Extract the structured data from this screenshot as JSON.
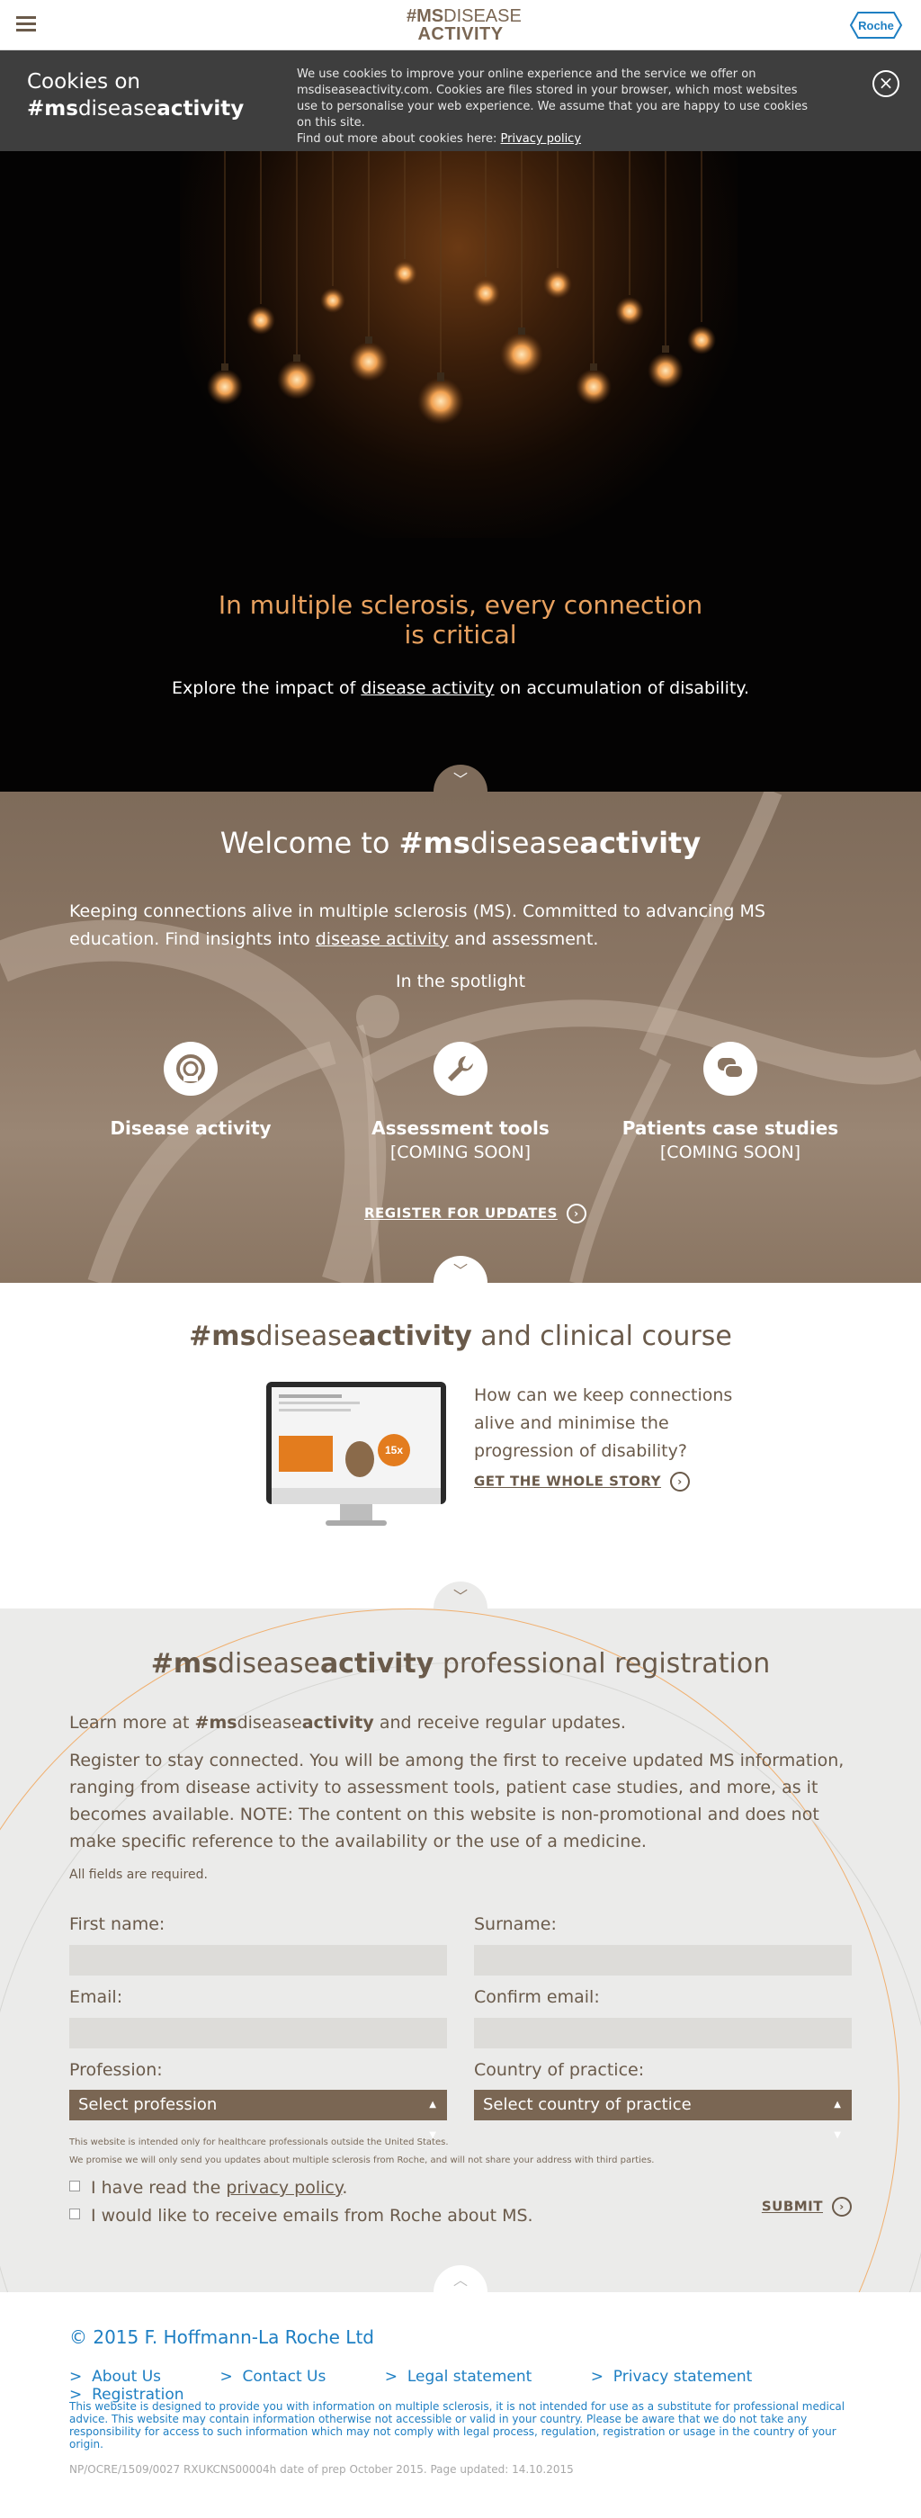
{
  "header": {
    "logo_line1_bold": "#MS",
    "logo_line1_rest": "DISEASE",
    "logo_line2": "ACTIVITY",
    "brand": "Roche",
    "colors": {
      "brand_brown": "#7a6653",
      "roche_blue": "#1e7fc3",
      "accent_orange": "#e8a15f"
    }
  },
  "cookie": {
    "title_line1": "Cookies on",
    "title_line2_pre": "#ms",
    "title_line2_mid": "disease",
    "title_line2_post": "activity",
    "text": "We use cookies to improve your online experience and the service we offer on msdiseaseactivity.com. Cookies are files stored in your browser, which most websites use to personalise your web experience. We assume that you are happy to use cookies on this site.",
    "find_out": "Find out more about cookies here: ",
    "privacy_link": "Privacy policy",
    "close_icon": "close-icon"
  },
  "hero": {
    "title_line1": "In multiple sclerosis, every connection",
    "title_line2": "is critical",
    "sub_pre": "Explore the impact of ",
    "sub_link": "disease activity",
    "sub_post": " on accumulation of disability."
  },
  "welcome": {
    "title_pre": "Welcome to ",
    "title_ms": "#ms",
    "title_disease": "disease",
    "title_activity": "activity",
    "intro_pre": "Keeping connections alive in multiple sclerosis (MS). Committed to advancing MS education. Find insights into ",
    "intro_link": "disease activity",
    "intro_post": " and assessment.",
    "spotlight": "In the spotlight",
    "features": [
      {
        "title": "Disease activity",
        "caption": "",
        "icon": "target-icon"
      },
      {
        "title": "Assessment tools",
        "caption": "[COMING SOON]",
        "icon": "wrench-icon"
      },
      {
        "title": "Patients case studies",
        "caption": "[COMING SOON]",
        "icon": "chat-bubbles-icon"
      }
    ],
    "register_link": "REGISTER FOR UPDATES"
  },
  "clinical": {
    "title_ms": "#ms",
    "title_disease": "disease",
    "title_activity": "activity",
    "title_post": " and clinical course",
    "question": "How can we keep connections alive and minimise the progression of disability?",
    "link": "GET THE WHOLE STORY",
    "monitor_badge": "15x"
  },
  "registration": {
    "title_ms": "#ms",
    "title_disease": "disease",
    "title_activity": "activity",
    "title_post": " professional registration",
    "learn_pre": "Learn more at ",
    "learn_ms": "#ms",
    "learn_disease": "disease",
    "learn_activity": "activity",
    "learn_post": " and receive regular updates.",
    "body": "Register to stay connected. You will be among the first to receive updated MS information, ranging from disease activity to assessment tools, patient case studies, and more, as it becomes available. NOTE: The content on this website is non-promotional and does not make specific reference to the availability or the use of a medicine.",
    "required": "All fields are required.",
    "first_name": "First name:",
    "surname": "Surname:",
    "email": "Email:",
    "confirm_email": "Confirm email:",
    "profession": "Profession:",
    "country": "Country of practice:",
    "profession_value": "Select profession",
    "country_value": "Select country of practice",
    "note1": "This website is intended only for healthcare professionals outside the United States.",
    "note2": "We promise we will only send you updates about multiple sclerosis from Roche, and will not share your address with third parties.",
    "check1_pre": "I have read the ",
    "check1_link": "privacy policy",
    "check1_post": ".",
    "check2": "I would like to receive emails from Roche about MS.",
    "submit": "SUBMIT"
  },
  "footer": {
    "copyright": "© 2015 F. Hoffmann-La Roche Ltd",
    "links": [
      "About Us",
      "Contact Us",
      "Legal statement",
      "Privacy statement",
      "Registration"
    ],
    "disclaimer": "This website is designed to provide you with information on multiple sclerosis, it is not intended for use as a substitute for professional medical advice. This website may contain information otherwise not accessible or valid in your country. Please be aware that we do not take any responsibility for access to such information which may not comply with legal process, regulation, registration or usage in the country of your origin.",
    "code": "NP/OCRE/1509/0027 RXUKCNS00004h date of prep October 2015. Page updated: 14.10.2015"
  }
}
